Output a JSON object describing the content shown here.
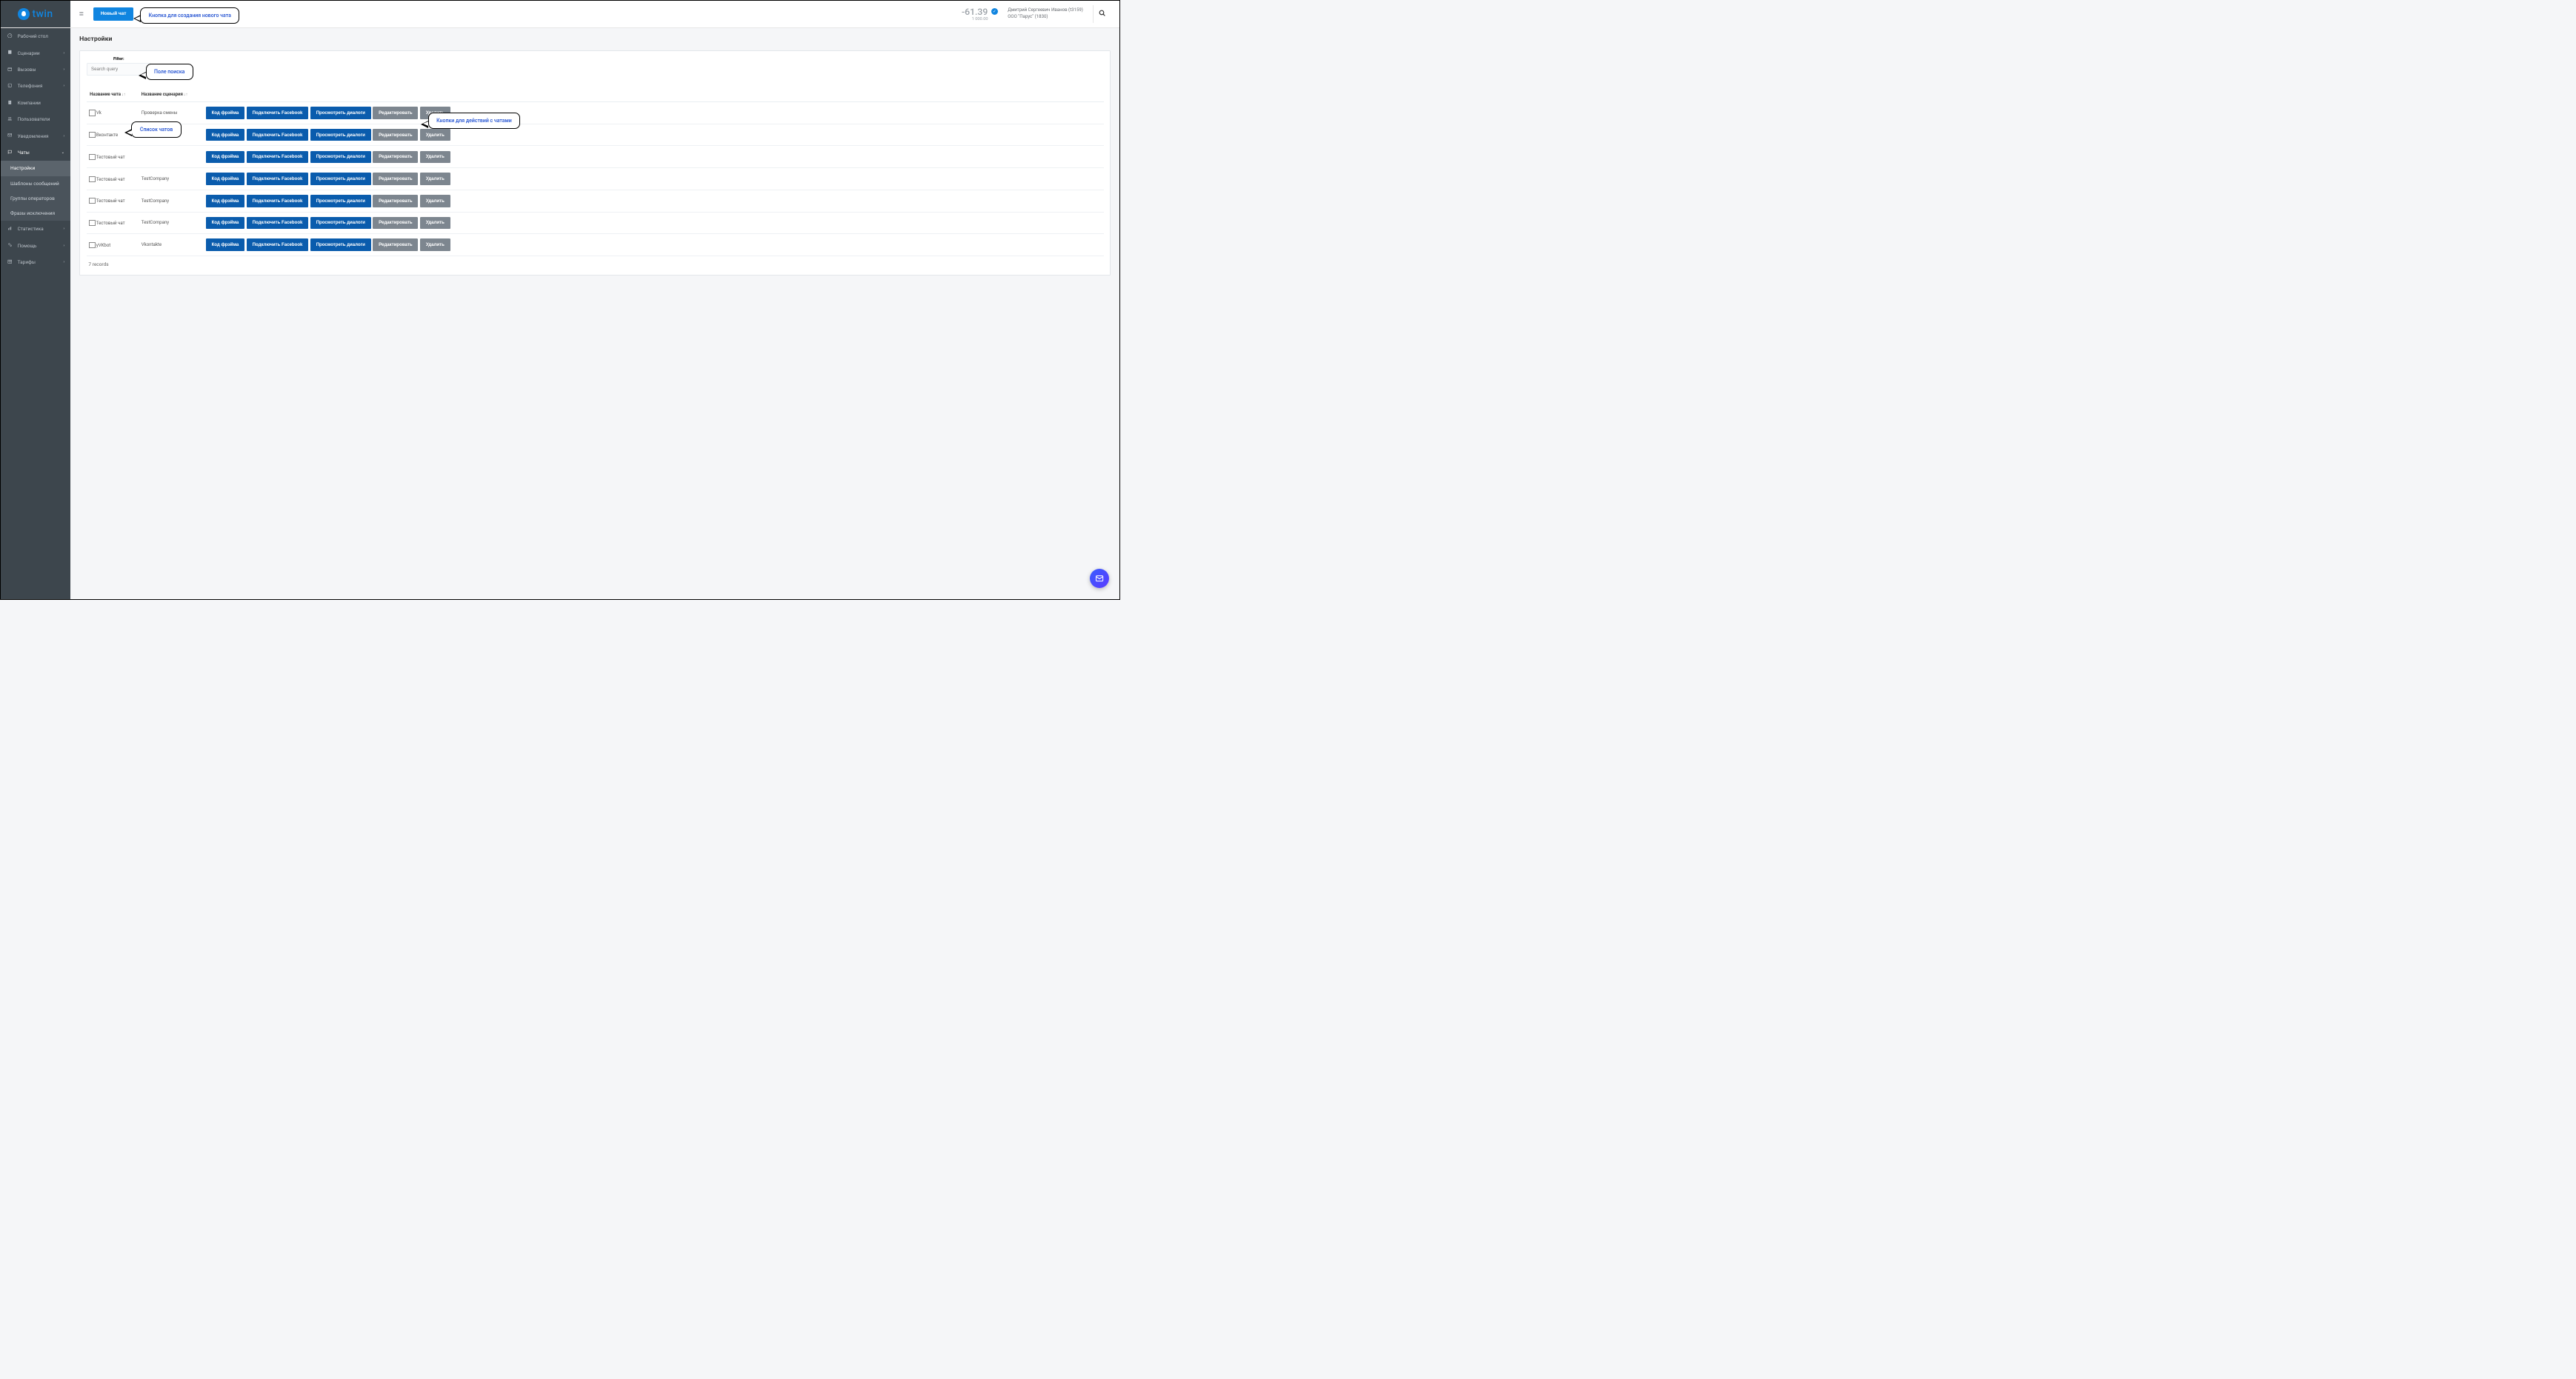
{
  "logo": {
    "text": "twin"
  },
  "header": {
    "new_chat": "Новый чат",
    "balance": "-61.39",
    "balance_sub": "1 000.00",
    "user_line1": "Дмитрий Сергеевич Иванов (t3159)",
    "user_line2": "ООО \"Парус\" (1830)"
  },
  "callouts": {
    "new_chat": "Кнопка для создания нового чата",
    "search": "Поле поиска",
    "list": "Список чатов",
    "actions": "Кнопки для действий с чатами"
  },
  "sidebar": {
    "items": [
      {
        "icon": "gauge",
        "label": "Рабочий стол",
        "expandable": false
      },
      {
        "icon": "book",
        "label": "Сценарии",
        "expandable": true
      },
      {
        "icon": "calendar",
        "label": "Вызовы",
        "expandable": true
      },
      {
        "icon": "phone",
        "label": "Телефония",
        "expandable": true
      },
      {
        "icon": "building",
        "label": "Компании",
        "expandable": false
      },
      {
        "icon": "users",
        "label": "Пользователи",
        "expandable": false
      },
      {
        "icon": "envelope",
        "label": "Уведомления",
        "expandable": true
      },
      {
        "icon": "chat",
        "label": "Чаты",
        "expandable": true,
        "active": true
      },
      {
        "icon": "chart",
        "label": "Статистика",
        "expandable": true
      },
      {
        "icon": "cogs",
        "label": "Помощь",
        "expandable": true
      },
      {
        "icon": "table",
        "label": "Тарифы",
        "expandable": true
      }
    ],
    "sub_chats": [
      {
        "label": "Настройки",
        "active": true
      },
      {
        "label": "Шаблоны сообщений"
      },
      {
        "label": "Группы операторов"
      },
      {
        "label": "Фразы исключения"
      }
    ]
  },
  "page": {
    "title": "Настройки",
    "filter_label": "Filter:",
    "search_placeholder": "Search query",
    "col_chat": "Название чата",
    "col_scen": "Название сценария",
    "records": "7 records"
  },
  "actions": {
    "frame": "Код фрэйма",
    "facebook": "Подключить Facebook",
    "dialogs": "Просмотреть диалоги",
    "edit": "Редактировать",
    "delete": "Удалить"
  },
  "rows": [
    {
      "chat": "Vk",
      "scen": "Проверка смены"
    },
    {
      "chat": "Вконтакте",
      "scen": ""
    },
    {
      "chat": "Тестовый чат",
      "scen": ""
    },
    {
      "chat": "Тестовый чат",
      "scen": "TestCompany"
    },
    {
      "chat": "Тестовый чат",
      "scen": "TestCompany"
    },
    {
      "chat": "Тестовый чат",
      "scen": "TestCompany"
    },
    {
      "chat": "yVKbot",
      "scen": "Vkontakte"
    }
  ],
  "icons": {
    "gauge": "⌬",
    "book": "▉",
    "calendar": "▦",
    "phone": "⌕",
    "building": "🏢",
    "users": "👥",
    "envelope": "✉",
    "chat": "Q",
    "chart": "⫾",
    "cogs": "⚙",
    "table": "▦",
    "hamburger": "≣",
    "check": "✓",
    "search": "🔍",
    "mail": "✉"
  }
}
